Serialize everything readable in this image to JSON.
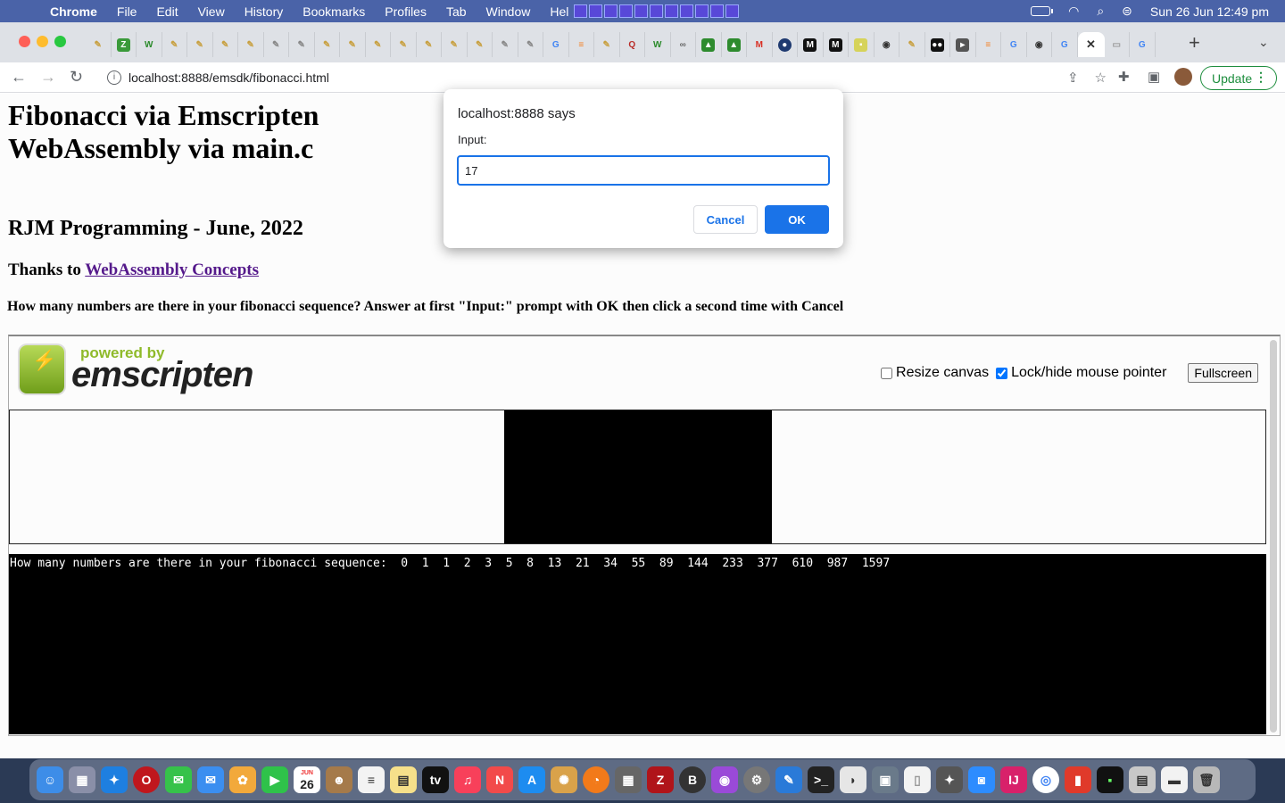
{
  "menubar": {
    "app": "Chrome",
    "items": [
      "File",
      "Edit",
      "View",
      "History",
      "Bookmarks",
      "Profiles",
      "Tab",
      "Window",
      "Hel"
    ],
    "datetime": "Sun 26 Jun  12:49 pm"
  },
  "browser": {
    "url": "localhost:8888/emsdk/fibonacci.html",
    "update_label": "Update",
    "new_tab": "+",
    "close_tab": "✕"
  },
  "page": {
    "title": "Fibonacci via Emscripten WebAssembly via main.c",
    "subtitle": "RJM Programming - June, 2022",
    "thanks_prefix": "Thanks to ",
    "thanks_link": "WebAssembly Concepts",
    "instructions": "How many numbers are there in your fibonacci sequence? Answer at first \"Input:\" prompt with OK then click a second time with Cancel"
  },
  "emscripten": {
    "powered_by": "powered by",
    "brand": "emscripten",
    "resize_label": "Resize canvas",
    "resize_checked": false,
    "lock_label": "Lock/hide mouse pointer",
    "lock_checked": true,
    "fullscreen_label": "Fullscreen",
    "output_text": "How many numbers are there in your fibonacci sequence:  0  1  1  2  3  5  8  13  21  34  55  89  144  233  377  610  987  1597"
  },
  "dialog": {
    "title": "localhost:8888 says",
    "message": "Input:",
    "value": "17",
    "cancel_label": "Cancel",
    "ok_label": "OK"
  },
  "dock": {
    "calendar_month": "JUN",
    "calendar_day": "26"
  }
}
